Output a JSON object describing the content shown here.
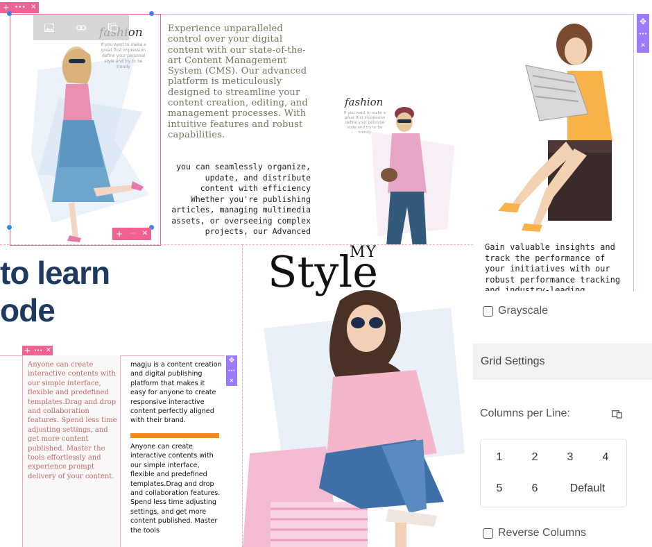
{
  "toolbar_tl": {
    "add": "+",
    "more": "•••",
    "close": "✕"
  },
  "image_tools": {
    "image": "image-icon",
    "link": "link-icon",
    "copy": "copy-icon"
  },
  "fashion_card": {
    "brand": "fashion",
    "tagline": "If you want to make a great first impression define your personal style and try to be trendy"
  },
  "fashion_card2": {
    "brand": "fashion",
    "tagline": "If you want to make a great first impression define your personal style and try to be trendy"
  },
  "intro_text": "Experience unparalleled control over your digital content with our state-of-the-art Content Management System (CMS). Our advanced platform is meticulously designed to streamline your content creation, editing, and management processes. With intuitive features and robust capabilities.",
  "mono_text": "you can seamlessly organize, update, and distribute content with efficiency Whether you're publishing articles, managing multimedia assets, or overseeing complex projects, our Advanced",
  "insights_text": "Gain valuable insights and track the performance of your initiatives with our robust performance tracking and industry-leading analytics",
  "toolbar_bottom": {
    "add": "+",
    "more": "···",
    "close": "✕"
  },
  "right_toolbar": {
    "move": "✥",
    "more": "•••",
    "close": "✕"
  },
  "headline": {
    "line1": "to learn",
    "line2": "ode"
  },
  "mystyle": {
    "my": "MY",
    "style": "Style"
  },
  "left_block": {
    "toolbar": {
      "add": "+",
      "more": "•••",
      "close": "✕"
    },
    "text": "Anyone can create interactive contents with our simple interface, flexible and predefined templates.Drag and drop and collaboration features. Spend less time adjusting settings, and get more content published. Master the tools effortlessly and experience prompt delivery of your content."
  },
  "mid_block": {
    "toolbar": {
      "move": "✥",
      "more": "•••",
      "close": "✕"
    },
    "intro": "magju is a content creation and digital publishing platform that makes it easy for anyone to create responsive interactive content perfectly aligned with their brand.",
    "bar_color": "#f5891f",
    "body": "Anyone can create interactive contents with our simple interface, flexible and predefined templates.Drag and drop and collaboration features. Spend less time adjusting settings, and get more content published. Master the tools"
  },
  "settings": {
    "grayscale_label": "Grayscale",
    "grayscale_checked": false,
    "grid_settings_title": "Grid Settings",
    "columns_label": "Columns per Line:",
    "device_icon": "devices-icon",
    "columns": [
      "1",
      "2",
      "3",
      "4",
      "5",
      "6",
      "Default"
    ],
    "reverse_label": "Reverse Columns",
    "reverse_checked": false
  },
  "colors": {
    "pink": "#f06292",
    "purple": "#9c7bff",
    "navy": "#1f3a5f",
    "orange": "#f5891f"
  }
}
